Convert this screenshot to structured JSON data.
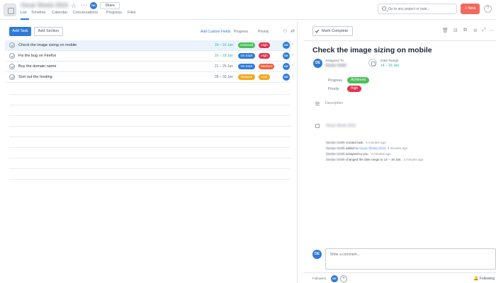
{
  "header": {
    "project_name": "Oscar Shorts 2019",
    "star_icon": "☆",
    "more_icon": "⋯",
    "avatar": "DE",
    "share_label": "Share",
    "tabs": [
      {
        "label": "List",
        "active": true
      },
      {
        "label": "Timeline",
        "active": false
      },
      {
        "label": "Calendar",
        "active": false
      },
      {
        "label": "Conversations",
        "active": false
      },
      {
        "label": "Progress",
        "active": false
      },
      {
        "label": "Files",
        "active": false
      }
    ],
    "search_placeholder": "Go to any project or task...",
    "new_label": "+ New",
    "help_label": "?"
  },
  "list": {
    "add_task_label": "Add Task",
    "add_section_label": "Add Section",
    "add_custom_fields_label": "Add Custom Fields",
    "col_progress": "Progress",
    "col_priority": "Priority",
    "tasks": [
      {
        "name": "Check the image sizing on mobile",
        "date": "14 – 16 Jan",
        "progress": "Achieved",
        "progress_color": "#4cc05a",
        "priority": "High",
        "priority_color": "#e0334d",
        "assignee": "DE",
        "selected": true
      },
      {
        "name": "Fix the bug on Firefox",
        "date": "16 – 18 Jan",
        "progress": "On track",
        "progress_color": "#2f7ad9",
        "priority": "High",
        "priority_color": "#e0334d",
        "assignee": "DE",
        "selected": false
      },
      {
        "name": "Buy the domain name",
        "date": "21 – 25 Jan",
        "progress": "On track",
        "progress_color": "#2f7ad9",
        "priority": "Medium",
        "priority_color": "#f0633d",
        "assignee": "DE",
        "selected": false
      },
      {
        "name": "Sort out the hosting",
        "date": "28 – 30 Jan",
        "progress": "Delayed",
        "progress_color": "#f2a81f",
        "priority": "Low",
        "priority_color": "#f2a81f",
        "assignee": "DE",
        "selected": false
      }
    ]
  },
  "detail": {
    "mark_complete_label": "Mark Complete",
    "title": "Check the image sizing on mobile",
    "assigned_to_label": "Assigned To",
    "assignee_name": "Declan Smith",
    "assignee_avatar": "DE",
    "date_range_label": "Date Range",
    "date_range": "14 – 16 Jan",
    "progress_label": "Progress",
    "progress_value": "Achieved",
    "priority_label": "Priority",
    "priority_value": "High",
    "description_placeholder": "Description",
    "project_tag": "Oscar Shorts 2019",
    "activity": [
      {
        "who": "Declan Smith",
        "action": " created task.",
        "link": "",
        "time": "5 minutes ago"
      },
      {
        "who": "Declan Smith",
        "action": " added to ",
        "link": "Oscar Shorts 2019",
        "time": "3 minutes ago"
      },
      {
        "who": "Declan Smith",
        "action": " assigned to you.",
        "link": "",
        "time": "3 minutes ago"
      },
      {
        "who": "Declan Smith",
        "action": " changed the date range to 14 – 16 Jan.",
        "link": "",
        "time": "3 minutes ago"
      }
    ],
    "comment_placeholder": "Write a comment...",
    "comment_avatar": "DE",
    "followers_label": "Followers",
    "follower_avatar": "DE",
    "add_follower_label": "+",
    "following_label": "Following"
  }
}
